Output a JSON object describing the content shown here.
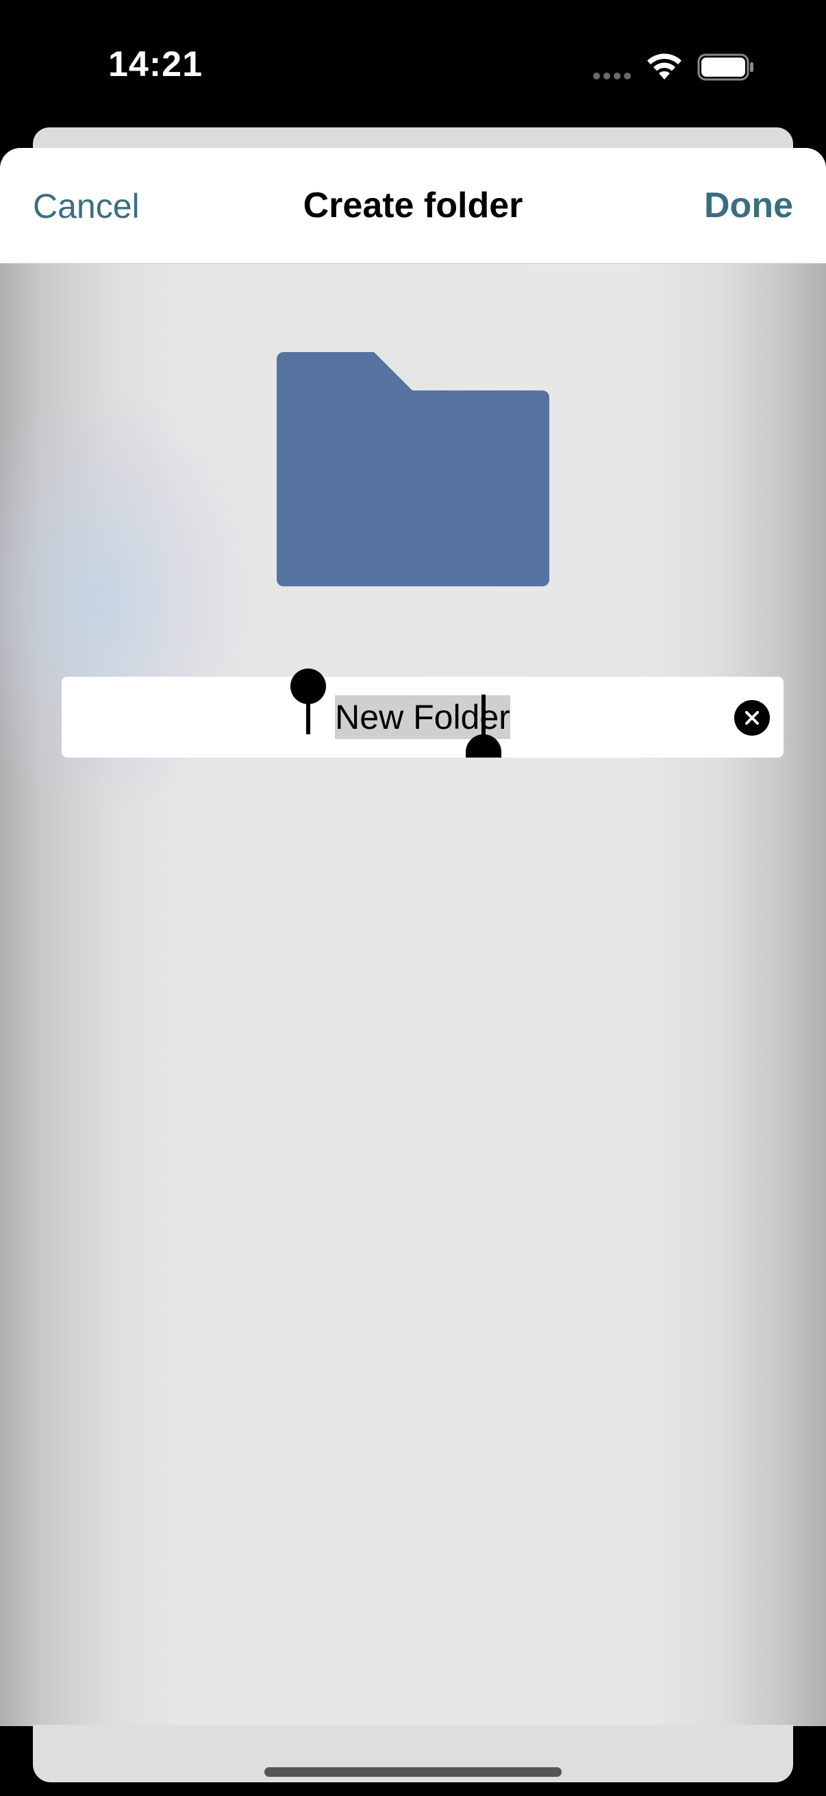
{
  "status_bar": {
    "time": "14:21",
    "icons": [
      "signal-dots-icon",
      "wifi-icon",
      "battery-icon"
    ]
  },
  "nav": {
    "cancel_label": "Cancel",
    "title": "Create folder",
    "done_label": "Done"
  },
  "folder": {
    "icon": "folder-icon",
    "color": "#5673a0"
  },
  "name_field": {
    "value": "New Folder",
    "selected": true,
    "clear_icon": "clear-circle-icon"
  },
  "colors": {
    "accent": "#3b6d80",
    "nav_background": "#ffffff",
    "sheet_background": "#e6e6e6"
  }
}
